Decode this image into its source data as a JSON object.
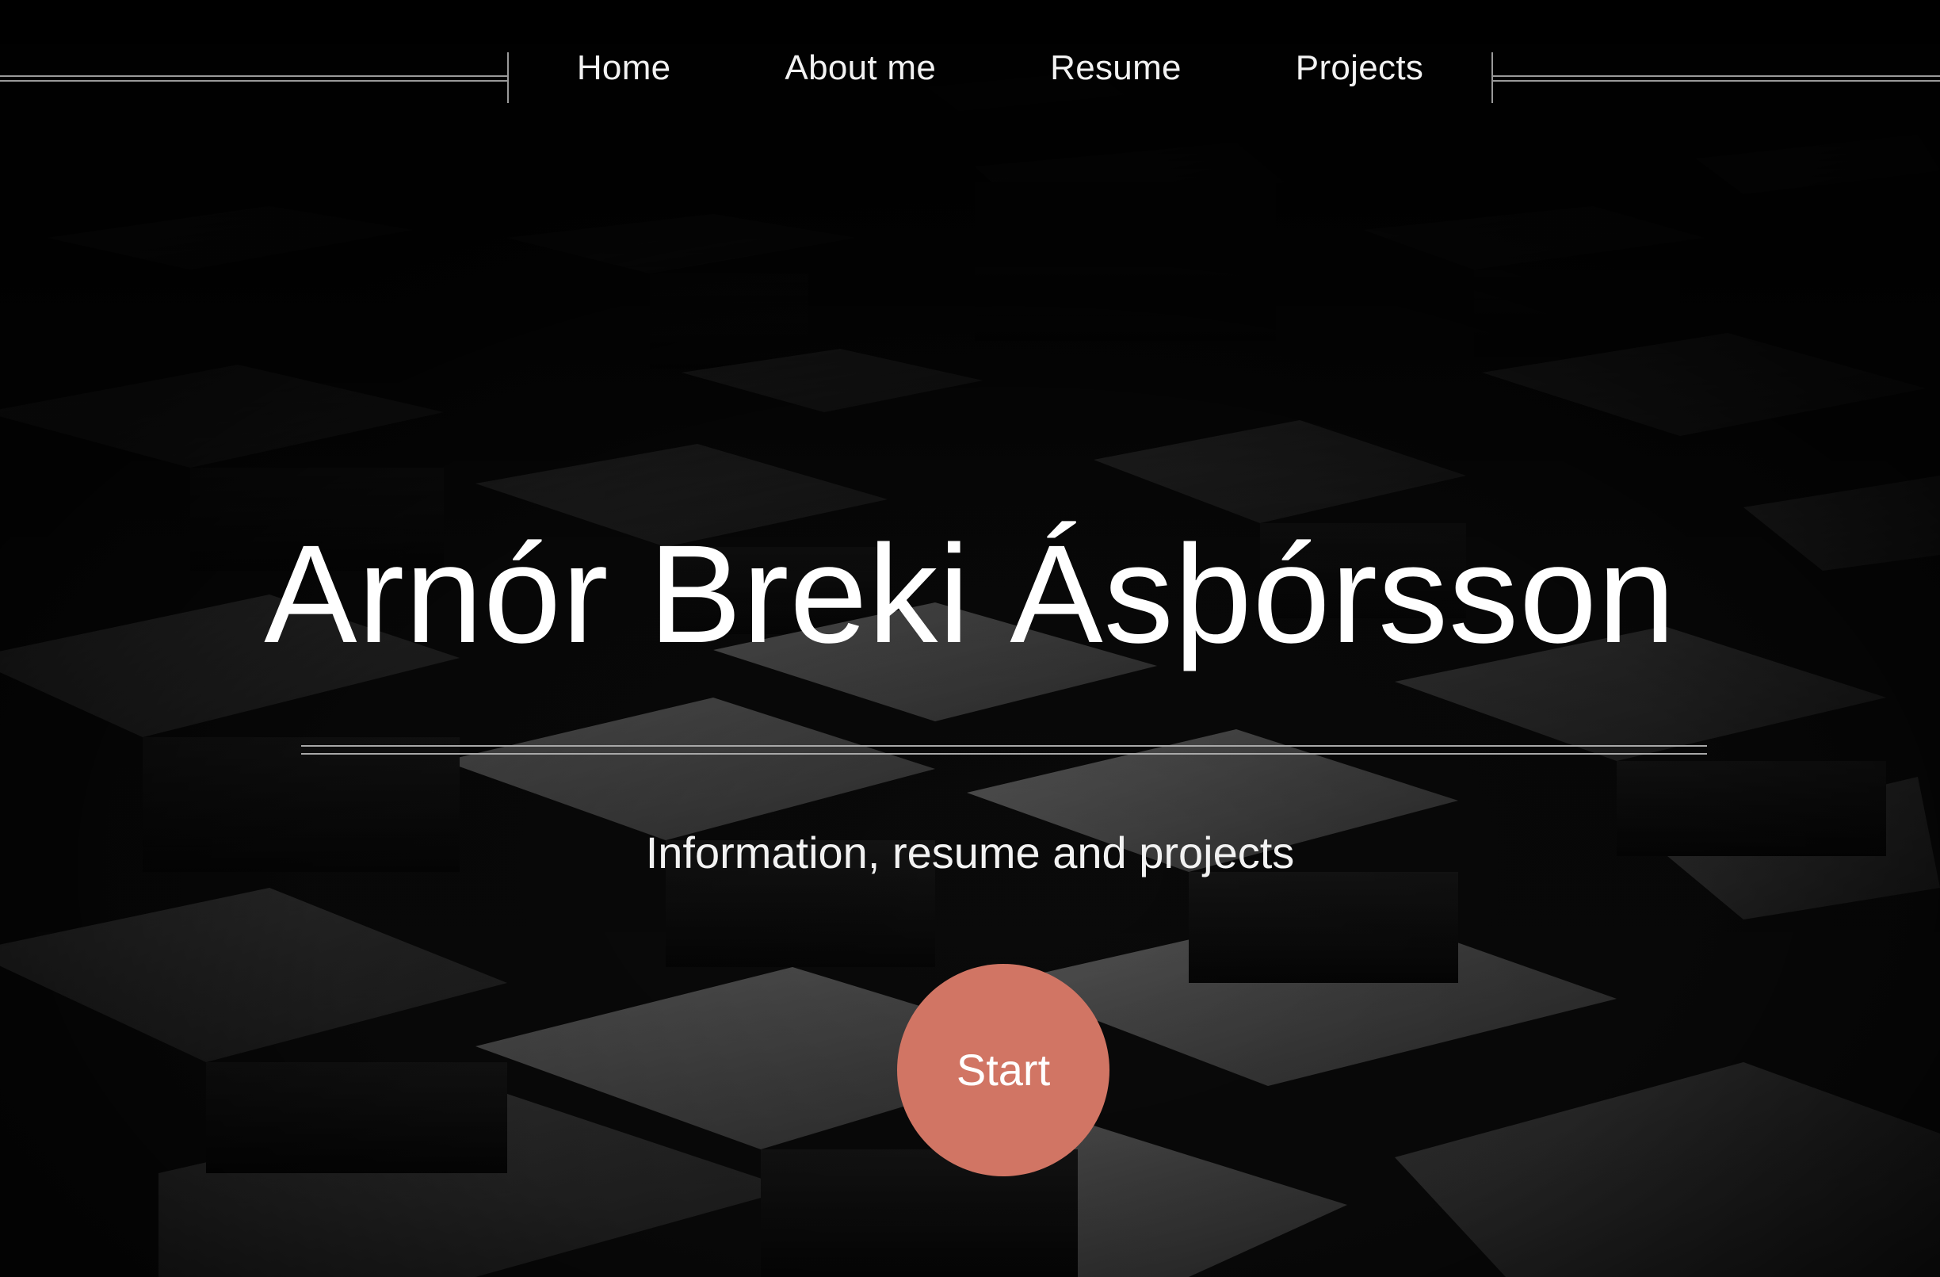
{
  "nav": {
    "items": [
      {
        "label": "Home"
      },
      {
        "label": "About me"
      },
      {
        "label": "Resume"
      },
      {
        "label": "Projects"
      }
    ]
  },
  "hero": {
    "title": "Arnór Breki Ásþórsson",
    "subtitle": "Information, resume and projects",
    "start_label": "Start"
  },
  "colors": {
    "accent": "#d17564",
    "background": "#050505",
    "text": "#ffffff",
    "rule": "#a8a8a8"
  }
}
